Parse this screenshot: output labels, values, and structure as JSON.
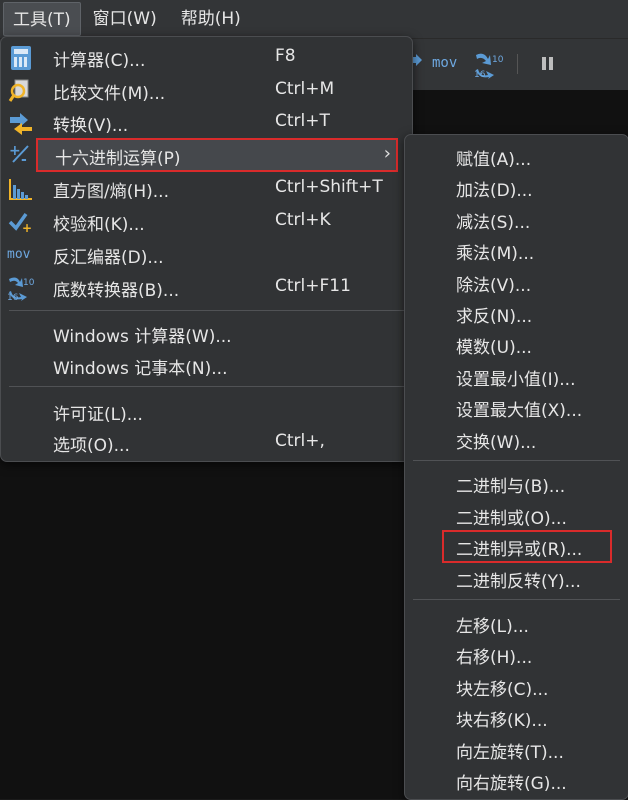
{
  "menubar": {
    "items": [
      {
        "label": "工具(T)"
      },
      {
        "label": "窗口(W)"
      },
      {
        "label": "帮助(H)"
      }
    ]
  },
  "toolbar": {
    "mov_label": "mov"
  },
  "tools_menu": {
    "items": [
      {
        "icon": "calculator-icon",
        "label": "计算器(C)...",
        "shortcut": "F8"
      },
      {
        "icon": "compare-files-icon",
        "label": "比较文件(M)...",
        "shortcut": "Ctrl+M"
      },
      {
        "icon": "convert-icon",
        "label": "转换(V)...",
        "shortcut": "Ctrl+T"
      },
      {
        "icon": "hex-operations-icon",
        "label": "十六进制运算(P)",
        "shortcut": ""
      },
      {
        "icon": "histogram-icon",
        "label": "直方图/熵(H)...",
        "shortcut": "Ctrl+Shift+T"
      },
      {
        "icon": "checksum-icon",
        "label": "校验和(K)...",
        "shortcut": "Ctrl+K"
      },
      {
        "icon": "disassembler-icon",
        "label": "反汇编器(D)...",
        "shortcut": ""
      },
      {
        "icon": "base-converter-icon",
        "label": "底数转换器(B)...",
        "shortcut": "Ctrl+F11"
      },
      {
        "label": "Windows 计算器(W)..."
      },
      {
        "label": "Windows 记事本(N)..."
      },
      {
        "label": "许可证(L)..."
      },
      {
        "label": "选项(O)...",
        "shortcut": "Ctrl+,"
      }
    ],
    "disasm_icon_text": "mov"
  },
  "hex_submenu": {
    "items": [
      "赋值(A)...",
      "加法(D)...",
      "减法(S)...",
      "乘法(M)...",
      "除法(V)...",
      "求反(N)...",
      "模数(U)...",
      "设置最小值(I)...",
      "设置最大值(X)...",
      "交换(W)...",
      "二进制与(B)...",
      "二进制或(O)...",
      "二进制异或(R)...",
      "二进制反转(Y)...",
      "左移(L)...",
      "右移(H)...",
      "块左移(C)...",
      "块右移(K)...",
      "向左旋转(T)...",
      "向右旋转(G)..."
    ]
  },
  "colors": {
    "highlight_border": "#d92b2b",
    "menu_bg": "#313335"
  }
}
